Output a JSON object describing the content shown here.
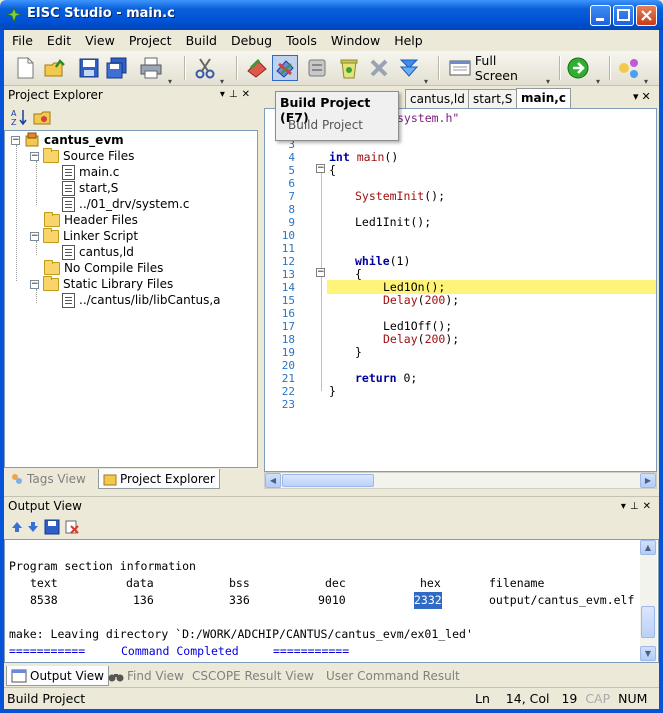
{
  "window": {
    "title": "EISC Studio - main.c"
  },
  "menu": [
    "File",
    "Edit",
    "View",
    "Project",
    "Build",
    "Debug",
    "Tools",
    "Window",
    "Help"
  ],
  "toolbar": {
    "fullscreen_label": "Full Screen"
  },
  "tooltip": {
    "title": "Build Project (F7)",
    "body": "Build Project"
  },
  "project_explorer": {
    "header": "Project Explorer",
    "root": "cantus_evm",
    "source_files": "Source Files",
    "src_main": "main.c",
    "src_start": "start,S",
    "src_system": "../01_drv/system.c",
    "header_files": "Header Files",
    "linker_script": "Linker Script",
    "linker_file": "cantus,ld",
    "no_compile": "No Compile Files",
    "static_lib": "Static Library Files",
    "lib_file": "../cantus/lib/libCantus,a",
    "tab_tags": "Tags View",
    "tab_explorer": "Project Explorer"
  },
  "editor": {
    "tabs": [
      "cantus,ld",
      "start,S",
      "main,c"
    ],
    "header_fragment": "system.h\"",
    "line_numbers": [
      "3",
      "4",
      "5",
      "6",
      "7",
      "8",
      "9",
      "10",
      "11",
      "12",
      "13",
      "14",
      "15",
      "16",
      "17",
      "18",
      "19",
      "20",
      "21",
      "22",
      "23"
    ],
    "code": {
      "l4_kw": "int",
      "l4_fn": "main",
      "l4_rest": "()",
      "l5": "{",
      "l7_fn": "SystemInit",
      "l7_rest": "();",
      "l9": "Led1Init();",
      "l12_kw": "while",
      "l12_rest": "(1)",
      "l13": "{",
      "l14": "Led1On();",
      "l15_fn": "Delay",
      "l15_num": "200",
      "l17": "Led1Off();",
      "l18_fn": "Delay",
      "l18_num": "200",
      "l19": "}",
      "l21_kw": "return",
      "l21_rest": "0;",
      "l22": "}"
    }
  },
  "output": {
    "header": "Output View",
    "line1": "Program section information",
    "cols": [
      "text",
      "data",
      "bss",
      "dec",
      "hex",
      "filename"
    ],
    "vals": [
      "8538",
      "136",
      "336",
      "9010",
      "2332",
      "output/cantus_evm.elf"
    ],
    "make_line": "make: Leaving directory `D:/WORK/ADCHIP/CANTUS/cantus_evm/ex01_led'",
    "done_left": "===========",
    "done_mid": "Command Completed",
    "done_right": "==========="
  },
  "bottom_tabs": [
    "Output View",
    "Find View",
    "CSCOPE Result View",
    "User Command Result"
  ],
  "status": {
    "text": "Build Project",
    "ln_label": "Ln",
    "ln": "14,",
    "col_label": "Col",
    "col": "19",
    "cap": "CAP",
    "num": "NUM"
  }
}
